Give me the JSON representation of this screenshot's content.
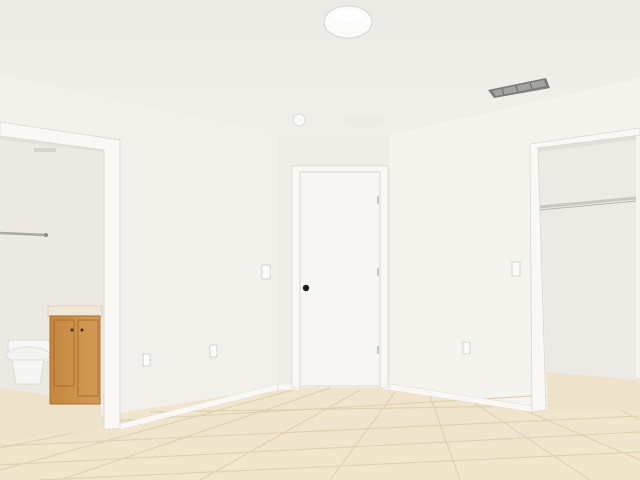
{
  "scene": {
    "description_free": true,
    "colors": {
      "ceiling": "#efede8",
      "wall_left": "#f3f1ec",
      "wall_back": "#f2efe8",
      "wall_right": "#f4f2ec",
      "floor": "#efe3c9",
      "grout": "#e2d3b4",
      "trim": "#f8f7f3",
      "door": "#f8f7f4",
      "cabinet": "#c98f45",
      "cabinet_dark": "#a86f2f",
      "counter": "#efe6d2",
      "toilet": "#f7f7f5",
      "closet_wall": "#eceae6"
    }
  }
}
